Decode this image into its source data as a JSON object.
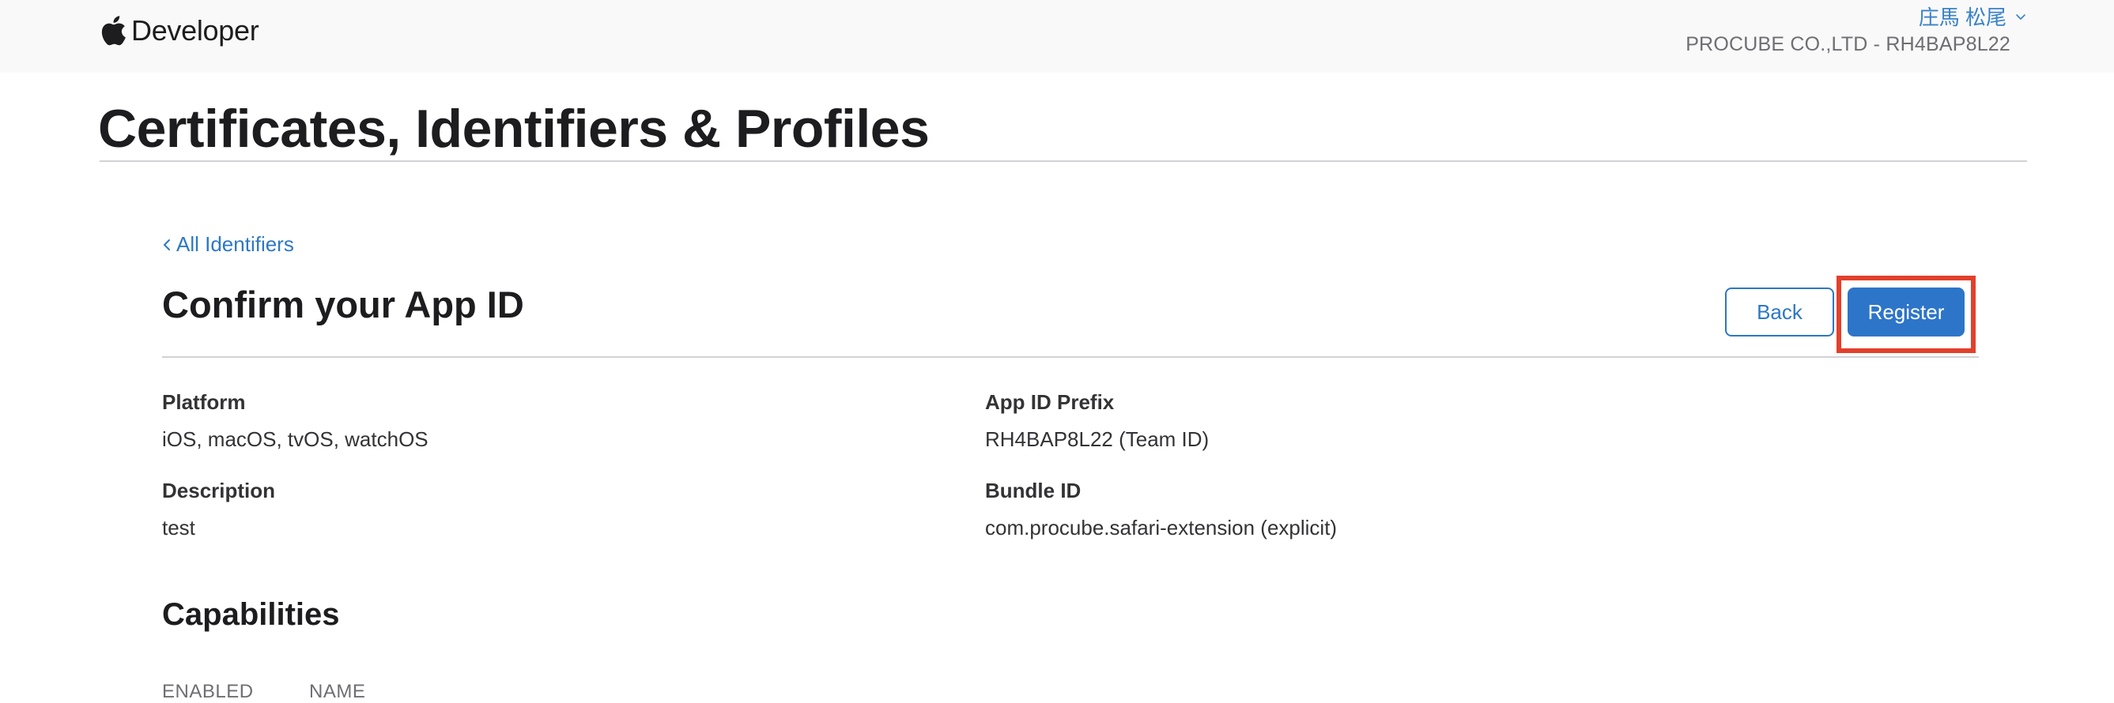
{
  "header": {
    "brand_label": "Developer",
    "user_name": "庄馬 松尾",
    "team": "PROCUBE CO.,LTD - RH4BAP8L22"
  },
  "page": {
    "title": "Certificates, Identifiers & Profiles"
  },
  "content": {
    "back_link": "All Identifiers",
    "heading": "Confirm your App ID",
    "back_button": "Back",
    "register_button": "Register",
    "fields": {
      "platform": {
        "label": "Platform",
        "value": "iOS, macOS, tvOS, watchOS"
      },
      "app_id_prefix": {
        "label": "App ID Prefix",
        "value": "RH4BAP8L22 (Team ID)"
      },
      "description": {
        "label": "Description",
        "value": "test"
      },
      "bundle_id": {
        "label": "Bundle ID",
        "value": "com.procube.safari-extension (explicit)"
      }
    },
    "capabilities": {
      "heading": "Capabilities",
      "columns": [
        "ENABLED",
        "NAME"
      ]
    }
  },
  "colors": {
    "link": "#2d78c4",
    "primary_button": "#2d75c8",
    "highlight": "#e2402c",
    "header_bg": "#f9f9f9"
  },
  "icons": [
    "apple-logo-icon",
    "chevron-down-icon",
    "chevron-left-icon"
  ]
}
